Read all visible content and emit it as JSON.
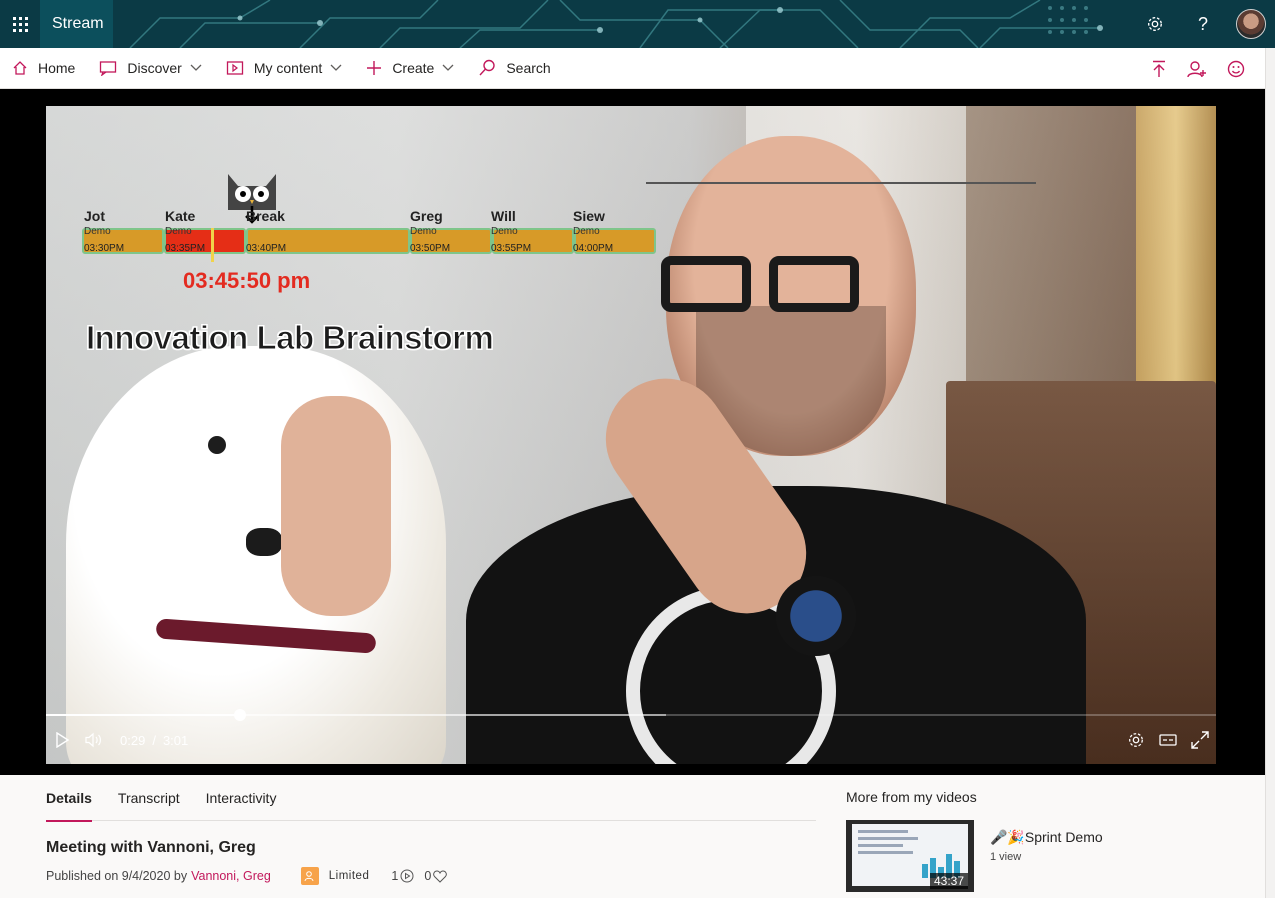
{
  "app": {
    "name": "Stream",
    "brand_color": "#c2185b",
    "suitebar_color": "#0b3a45"
  },
  "suite_icons": [
    "app-launcher-icon",
    "settings-icon",
    "help-icon",
    "avatar"
  ],
  "nav": {
    "home": "Home",
    "discover": "Discover",
    "my_content": "My content",
    "create": "Create",
    "search_placeholder": "Search",
    "right_icons": [
      "upload-icon",
      "add-user-icon",
      "feedback-icon"
    ]
  },
  "video": {
    "overlay": {
      "slots": [
        {
          "name": "Jot",
          "sub": "Demo",
          "time": "03:30PM"
        },
        {
          "name": "Kate",
          "sub": "Demo",
          "time": "03:35PM"
        },
        {
          "name": "Break",
          "sub": "",
          "time": "03:40PM"
        },
        {
          "name": "Greg",
          "sub": "Demo",
          "time": "03:50PM"
        },
        {
          "name": "Will",
          "sub": "Demo",
          "time": "03:55PM"
        },
        {
          "name": "Siew",
          "sub": "Demo",
          "time": "04:00PM"
        }
      ],
      "clock": "03:45:50 pm",
      "title": "Innovation Lab Brainstorm"
    },
    "player": {
      "current_time": "0:29",
      "separator": "/",
      "duration": "3:01",
      "progress_fraction": 0.166,
      "buffered_fraction": 0.53
    }
  },
  "details": {
    "tabs": [
      "Details",
      "Transcript",
      "Interactivity"
    ],
    "active_tab": "Details",
    "title": "Meeting with Vannoni, Greg",
    "published_prefix": "Published on 9/4/2020 by",
    "author": "Vannoni, Greg",
    "permission": "Limited",
    "views": "1",
    "likes": "0"
  },
  "more_from": {
    "heading": "More from my videos",
    "items": [
      {
        "title": "🎤🎉Sprint Demo",
        "views": "1 view",
        "duration": "43:37"
      }
    ]
  }
}
